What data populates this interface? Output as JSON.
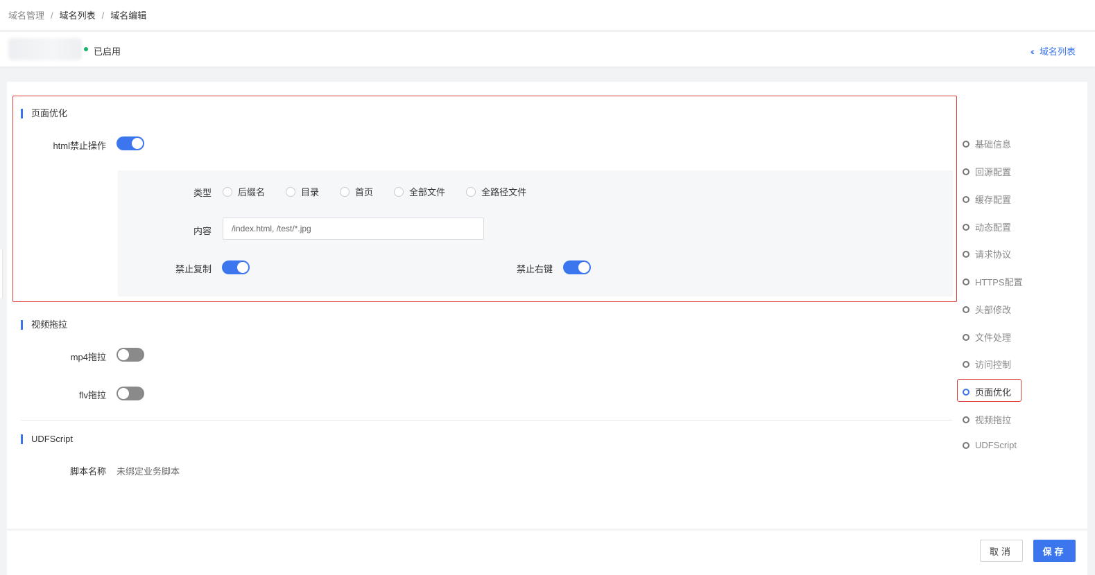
{
  "breadcrumb": {
    "items": [
      "域名管理",
      "域名列表",
      "域名编辑"
    ],
    "separator": "/"
  },
  "header": {
    "status": "已启用",
    "status_color": "#19b46b",
    "back_link": "域名列表"
  },
  "page_optimize": {
    "title": "页面优化",
    "html_forbid_label": "html禁止操作",
    "html_forbid_on": true,
    "type_label": "类型",
    "type_options": [
      "后缀名",
      "目录",
      "首页",
      "全部文件",
      "全路径文件"
    ],
    "content_label": "内容",
    "content_placeholder": "/index.html, /test/*.jpg",
    "no_copy_label": "禁止复制",
    "no_copy_on": true,
    "no_right_click_label": "禁止右键",
    "no_right_click_on": true
  },
  "video_drag": {
    "title": "视频拖拉",
    "mp4_label": "mp4拖拉",
    "mp4_on": false,
    "flv_label": "flv拖拉",
    "flv_on": false
  },
  "udf": {
    "title": "UDFScript",
    "script_name_label": "脚本名称",
    "script_name_value": "未绑定业务脚本"
  },
  "anchor_nav": {
    "items": [
      "基础信息",
      "回源配置",
      "缓存配置",
      "动态配置",
      "请求协议",
      "HTTPS配置",
      "头部修改",
      "文件处理",
      "访问控制",
      "页面优化",
      "视频拖拉",
      "UDFScript"
    ],
    "active": "页面优化"
  },
  "footer": {
    "cancel": "取消",
    "save": "保存"
  },
  "colors": {
    "accent": "#3b76ef",
    "highlight": "#e03b3b"
  }
}
